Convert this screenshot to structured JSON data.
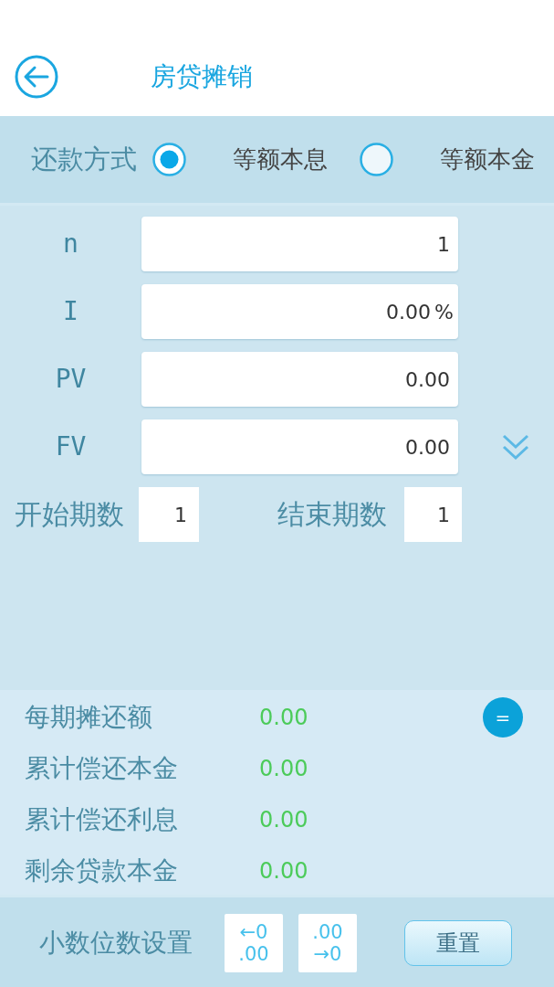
{
  "header": {
    "title": "房贷摊销"
  },
  "payment_method": {
    "label": "还款方式",
    "options": [
      {
        "label": "等额本息",
        "selected": true
      },
      {
        "label": "等额本金",
        "selected": false
      }
    ]
  },
  "fields": [
    {
      "label": "n",
      "value": "1"
    },
    {
      "label": "I",
      "value": "0.00",
      "unit": "%"
    },
    {
      "label": "PV",
      "value": "0.00"
    },
    {
      "label": "FV",
      "value": "0.00"
    }
  ],
  "periods": [
    {
      "label": "开始期数",
      "value": "1"
    },
    {
      "label": "结束期数",
      "value": "1"
    }
  ],
  "results": [
    {
      "label": "每期摊还额",
      "value": "0.00"
    },
    {
      "label": "累计偿还本金",
      "value": "0.00"
    },
    {
      "label": "累计偿还利息",
      "value": "0.00"
    },
    {
      "label": "剩余贷款本金",
      "value": "0.00"
    }
  ],
  "calculate_button": {
    "label": "="
  },
  "decimal_settings": {
    "label": "小数位数设置",
    "buttons": [
      {
        "lines": [
          "←0",
          ".00"
        ]
      },
      {
        "lines": [
          ".00",
          "→0"
        ]
      }
    ]
  },
  "reset_button": {
    "label": "重置"
  }
}
